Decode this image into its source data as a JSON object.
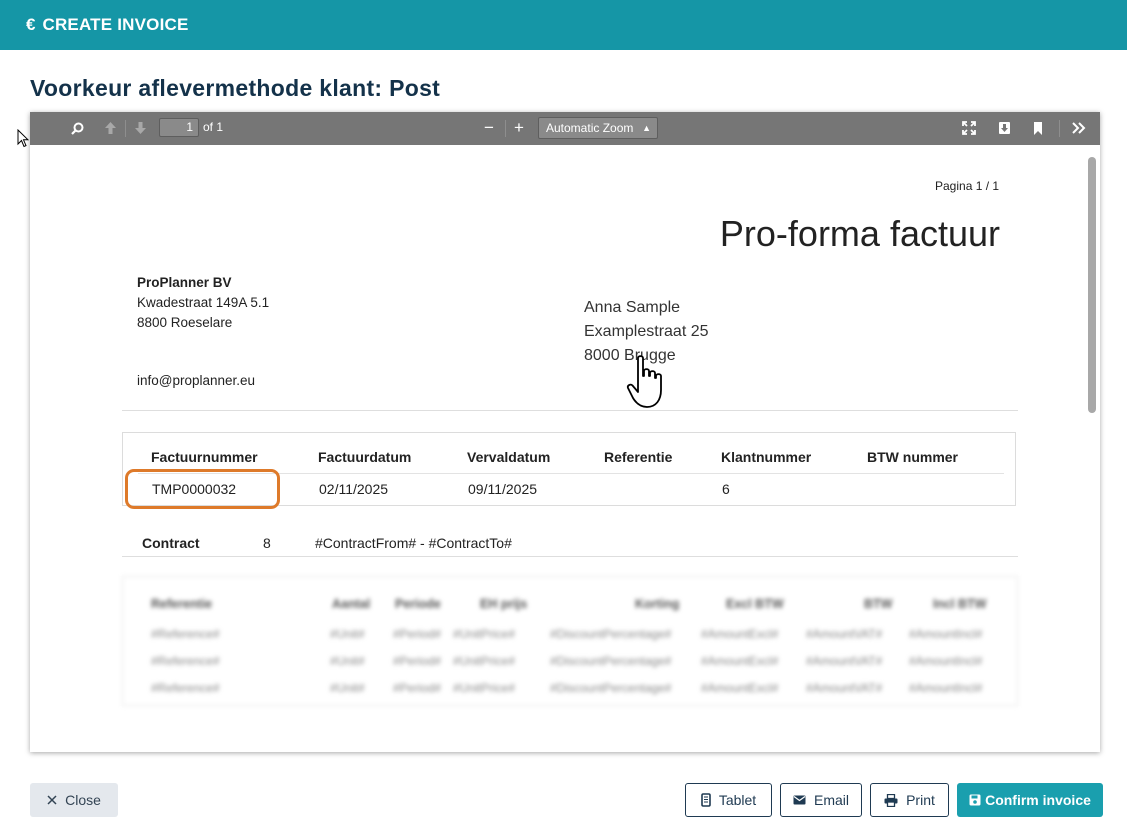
{
  "header": {
    "icon": "euro-icon",
    "title": "CREATE INVOICE",
    "bg_color": "#1596a6"
  },
  "page": {
    "heading": "Voorkeur aflevermethode klant: Post"
  },
  "viewer": {
    "page_number": "1",
    "page_total": "of 1",
    "zoom_label": "Automatic Zoom",
    "zoom_out": "−",
    "zoom_in": "+",
    "icons": [
      "search-icon",
      "previous-page-icon",
      "next-page-icon",
      "presentation-mode-icon",
      "download-icon",
      "bookmark-icon",
      "more-tools-icon"
    ]
  },
  "document": {
    "pagina": "Pagina 1 / 1",
    "title": "Pro-forma factuur",
    "sender": {
      "company": "ProPlanner BV",
      "street": "Kwadestraat 149A 5.1",
      "city": "8800 Roeselare",
      "email": "info@proplanner.eu"
    },
    "recipient": {
      "name": "Anna Sample",
      "street": "Examplestraat 25",
      "city": "8000 Brugge"
    },
    "info_table": {
      "headers": [
        "Factuurnummer",
        "Factuurdatum",
        "Vervaldatum",
        "Referentie",
        "Klantnummer",
        "BTW nummer"
      ],
      "values": [
        "TMP0000032",
        "02/11/2025",
        "09/11/2025",
        "",
        "6",
        ""
      ]
    },
    "contract": {
      "label": "Contract",
      "number": "8",
      "range": "#ContractFrom# - #ContractTo#"
    },
    "lines_table": {
      "headers": [
        "Referentie",
        "Aantal",
        "Periode",
        "EH prijs",
        "Korting",
        "Excl BTW",
        "BTW",
        "Incl BTW"
      ],
      "rows": [
        [
          "#Reference#",
          "#Unit#",
          "#Period#",
          "#UnitPrice#",
          "#DiscountPercentage#",
          "#AmountExcl#",
          "#AmountVAT#",
          "#AmountIncl#"
        ],
        [
          "#Reference#",
          "#Unit#",
          "#Period#",
          "#UnitPrice#",
          "#DiscountPercentage#",
          "#AmountExcl#",
          "#AmountVAT#",
          "#AmountIncl#"
        ],
        [
          "#Reference#",
          "#Unit#",
          "#Period#",
          "#UnitPrice#",
          "#DiscountPercentage#",
          "#AmountExcl#",
          "#AmountVAT#",
          "#AmountIncl#"
        ]
      ]
    }
  },
  "footer": {
    "close_label": "Close",
    "tablet_label": "Tablet",
    "email_label": "Email",
    "print_label": "Print",
    "confirm_label": "Confirm invoice",
    "primary_color": "#1a9fae",
    "highlight_color": "#de7a2a"
  }
}
